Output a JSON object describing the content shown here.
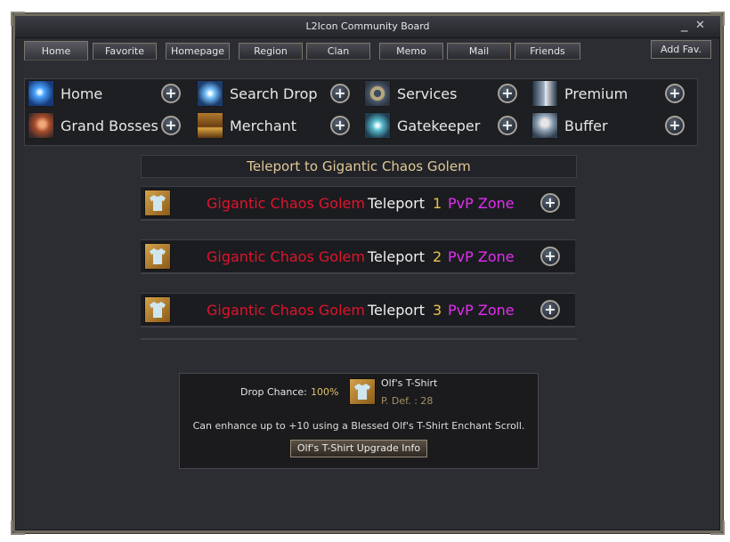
{
  "window": {
    "title": "L2Icon Community Board",
    "minimize_glyph": "_",
    "close_glyph": "✕"
  },
  "tabs": [
    {
      "label": "Home",
      "active": true
    },
    {
      "label": "Favorite"
    },
    {
      "label": "Homepage"
    },
    {
      "label": "Region"
    },
    {
      "label": "Clan"
    },
    {
      "label": "Memo"
    },
    {
      "label": "Mail"
    },
    {
      "label": "Friends"
    }
  ],
  "add_fav": "Add Fav.",
  "menu": [
    {
      "label": "Home",
      "icon": "home-icon"
    },
    {
      "label": "Search Drop",
      "icon": "search-drop-icon"
    },
    {
      "label": "Services",
      "icon": "services-icon"
    },
    {
      "label": "Premium",
      "icon": "premium-icon"
    },
    {
      "label": "Grand Bosses",
      "icon": "grand-bosses-icon"
    },
    {
      "label": "Merchant",
      "icon": "merchant-icon"
    },
    {
      "label": "Gatekeeper",
      "icon": "gatekeeper-icon"
    },
    {
      "label": "Buffer",
      "icon": "buffer-icon"
    }
  ],
  "plus_glyph": "+",
  "teleport": {
    "header": "Teleport to Gigantic Chaos Golem",
    "rows": [
      {
        "name": "Gigantic Chaos Golem",
        "action": "Teleport",
        "number": "1",
        "zone": "PvP Zone"
      },
      {
        "name": "Gigantic Chaos Golem",
        "action": "Teleport",
        "number": "2",
        "zone": "PvP Zone"
      },
      {
        "name": "Gigantic Chaos Golem",
        "action": "Teleport",
        "number": "3",
        "zone": "PvP Zone"
      }
    ]
  },
  "drop": {
    "label": "Drop Chance:",
    "chance": "100%",
    "item_name": "Olf's T-Shirt",
    "item_stat": "P. Def. : 28",
    "description": "Can enhance up to +10 using a Blessed Olf's T-Shirt Enchant Scroll.",
    "button": "Olf's T-Shirt Upgrade Info"
  },
  "colors": {
    "boss_name": "#e0142c",
    "zone": "#e12ef0",
    "number": "#ecc34a",
    "header_text": "#e1c896"
  }
}
